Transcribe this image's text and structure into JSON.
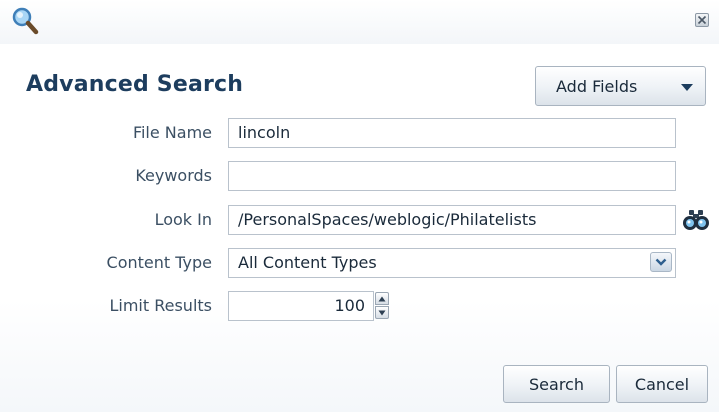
{
  "dialog": {
    "title": "Advanced Search",
    "add_fields_label": "Add Fields"
  },
  "form": {
    "file_name": {
      "label": "File Name",
      "value": "lincoln"
    },
    "keywords": {
      "label": "Keywords",
      "value": ""
    },
    "look_in": {
      "label": "Look In",
      "value": "/PersonalSpaces/weblogic/Philatelists"
    },
    "content_type": {
      "label": "Content Type",
      "value": "All Content Types"
    },
    "limit_results": {
      "label": "Limit Results",
      "value": "100"
    }
  },
  "actions": {
    "search_label": "Search",
    "cancel_label": "Cancel"
  },
  "icons": {
    "header": "magnifier-icon",
    "close": "close-icon",
    "browse": "binoculars-icon",
    "dropdown": "chevron-down-icon",
    "add_fields_caret": "caret-down-icon",
    "spin_up": "spin-up-icon",
    "spin_down": "spin-down-icon"
  },
  "colors": {
    "title": "#1d3d5e",
    "label": "#3b4f63",
    "field_border": "#b9c2cc"
  }
}
